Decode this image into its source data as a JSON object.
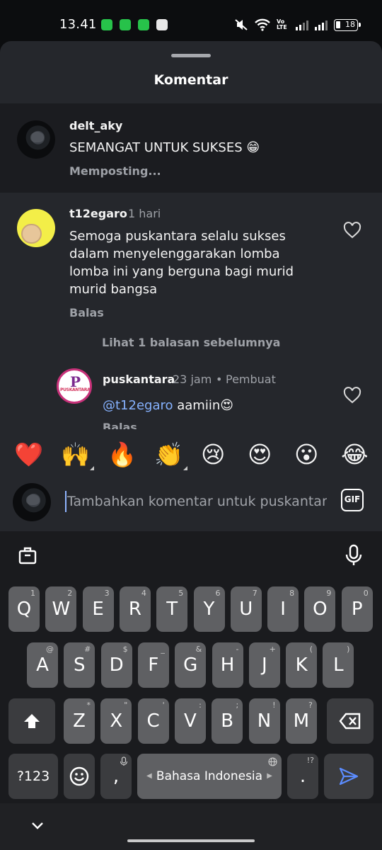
{
  "status_bar": {
    "time": "13.41",
    "battery": "18",
    "volte": "Vo LTE"
  },
  "sheet": {
    "title": "Komentar"
  },
  "comments": [
    {
      "username": "delt_aky",
      "text": "SEMANGAT UNTUK SUKSES 😁",
      "status": "Memposting..."
    },
    {
      "username": "t12egaro",
      "time": "1 hari",
      "text_lines": [
        "Semoga puskantara selalu sukses",
        "dalam menyelenggarakan lomba",
        "lomba ini yang berguna bagi murid",
        "murid bangsa"
      ],
      "reply_label": "Balas",
      "view_replies": "Lihat 1 balasan sebelumnya"
    },
    {
      "username": "puskantara",
      "time": "23 jam",
      "separator": "•",
      "badge": "Pembuat",
      "mention": "@t12egaro",
      "text": " aamiin😍",
      "reply_label": "Balas",
      "avatar_text": "PUSKANTARA"
    }
  ],
  "emoji_reactions": [
    "❤️",
    "🙌",
    "🔥",
    "👏",
    "😢",
    "😍",
    "😮",
    "😂"
  ],
  "input": {
    "placeholder": "Tambahkan komentar untuk puskantara...",
    "gif_label": "GIF"
  },
  "keyboard": {
    "row1": [
      {
        "key": "Q",
        "hint": "1"
      },
      {
        "key": "W",
        "hint": "2"
      },
      {
        "key": "E",
        "hint": "3"
      },
      {
        "key": "R",
        "hint": "4"
      },
      {
        "key": "T",
        "hint": "5"
      },
      {
        "key": "Y",
        "hint": "6"
      },
      {
        "key": "U",
        "hint": "7"
      },
      {
        "key": "I",
        "hint": "8"
      },
      {
        "key": "O",
        "hint": "9"
      },
      {
        "key": "P",
        "hint": "0"
      }
    ],
    "row2": [
      {
        "key": "A",
        "hint": "@"
      },
      {
        "key": "S",
        "hint": "#"
      },
      {
        "key": "D",
        "hint": "$"
      },
      {
        "key": "F",
        "hint": "_"
      },
      {
        "key": "G",
        "hint": "&"
      },
      {
        "key": "H",
        "hint": "-"
      },
      {
        "key": "J",
        "hint": "+"
      },
      {
        "key": "K",
        "hint": "("
      },
      {
        "key": "L",
        "hint": ")"
      }
    ],
    "row3": [
      {
        "key": "Z",
        "hint": "*"
      },
      {
        "key": "X",
        "hint": "\""
      },
      {
        "key": "C",
        "hint": "'"
      },
      {
        "key": "V",
        "hint": ":"
      },
      {
        "key": "B",
        "hint": ";"
      },
      {
        "key": "N",
        "hint": "!"
      },
      {
        "key": "M",
        "hint": "?"
      }
    ],
    "symbols_label": "?123",
    "comma": ",",
    "period": ".",
    "period_hint": "!?",
    "space_label": "Bahasa Indonesia"
  }
}
